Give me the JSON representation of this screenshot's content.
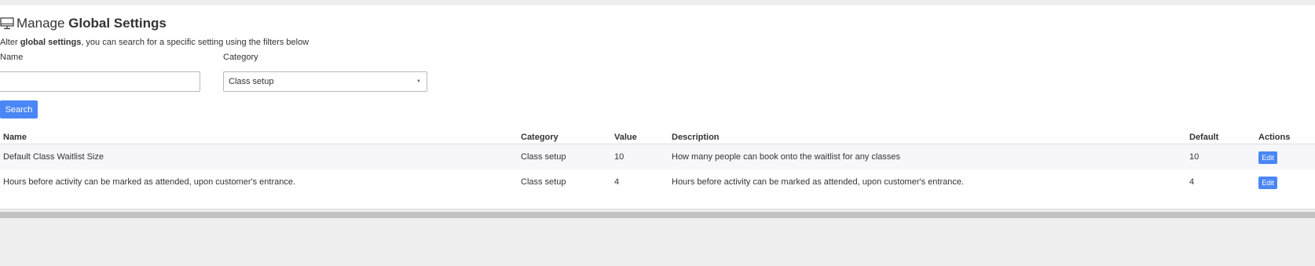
{
  "header": {
    "title_light": "Manage ",
    "title_bold": "Global Settings",
    "icon": "monitor-icon",
    "subtitle_prefix": "Alter ",
    "subtitle_bold": "global settings",
    "subtitle_suffix": ", you can search for a specific setting using the filters below"
  },
  "filters": {
    "name_label": "Name",
    "name_value": "",
    "name_placeholder": "",
    "category_label": "Category",
    "category_value": "Class setup",
    "search_label": "Search"
  },
  "table": {
    "columns": [
      "Name",
      "Category",
      "Value",
      "Description",
      "Default",
      "Actions"
    ],
    "rows": [
      {
        "name": "Default Class Waitlist Size",
        "category": "Class setup",
        "value": "10",
        "description": "How many people can book onto the waitlist for any classes",
        "default": "10",
        "action": "Edit"
      },
      {
        "name": "Hours before activity can be marked as attended, upon customer's entrance.",
        "category": "Class setup",
        "value": "4",
        "description": "Hours before activity can be marked as attended, upon customer's entrance.",
        "default": "4",
        "action": "Edit"
      }
    ]
  },
  "colors": {
    "accent": "#4a86f5",
    "page_bg": "#eeeeee",
    "panel_bg": "#ffffff",
    "row_stripe": "#f7f7f9"
  }
}
